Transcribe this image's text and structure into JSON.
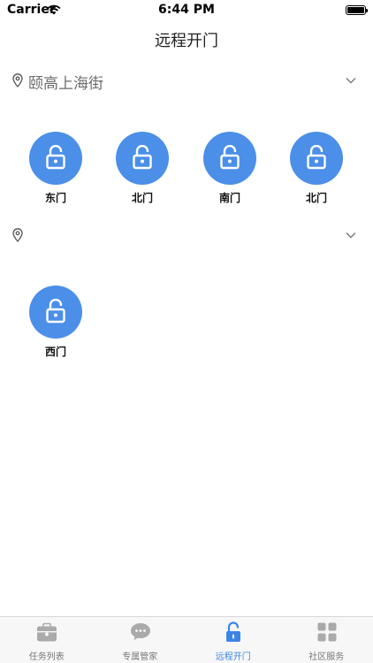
{
  "status_bar": {
    "carrier": "Carrier",
    "time": "6:44 PM"
  },
  "header": {
    "title": "远程开门"
  },
  "groups": [
    {
      "name": "颐高上海街",
      "doors": [
        {
          "label": "东门"
        },
        {
          "label": "北门"
        },
        {
          "label": "南门"
        },
        {
          "label": "北门"
        }
      ]
    },
    {
      "name": "",
      "doors": [
        {
          "label": "西门"
        }
      ]
    }
  ],
  "tabs": [
    {
      "label": "任务列表",
      "icon": "briefcase-icon",
      "active": false
    },
    {
      "label": "专属管家",
      "icon": "chat-bubbles-icon",
      "active": false
    },
    {
      "label": "远程开门",
      "icon": "unlock-icon",
      "active": true
    },
    {
      "label": "社区服务",
      "icon": "grid-icon",
      "active": false
    }
  ],
  "colors": {
    "accent": "#3d84e6",
    "door_button": "#4b8fe8",
    "tab_inactive": "#aaaaaa"
  }
}
